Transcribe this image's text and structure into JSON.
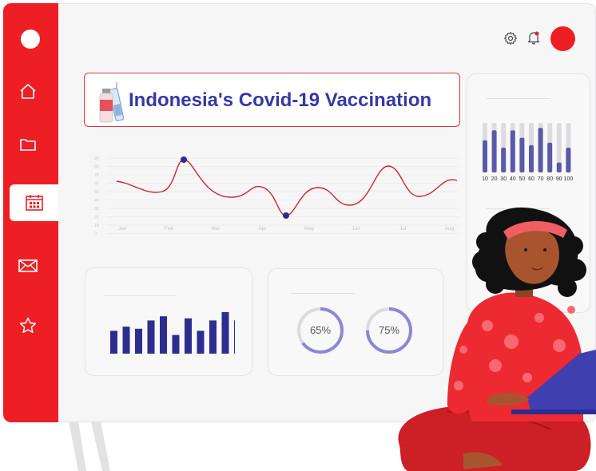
{
  "dashboard": {
    "title": "Indonesia's Covid-19 Vaccination"
  },
  "sidebar": {
    "items": [
      {
        "icon": "home-icon"
      },
      {
        "icon": "folder-icon"
      },
      {
        "icon": "calendar-icon",
        "active": true
      },
      {
        "icon": "mail-icon"
      },
      {
        "icon": "star-icon"
      }
    ]
  },
  "header": {
    "icons": [
      "gear-icon",
      "bell-icon"
    ]
  },
  "line_chart": {
    "months": [
      "Jan",
      "Feb",
      "Mar",
      "Apr",
      "May",
      "Jun",
      "Jul",
      "Aug"
    ],
    "y_ticks": [
      "90",
      "80",
      "70",
      "60",
      "50",
      "40",
      "30",
      "20",
      "10",
      "0"
    ]
  },
  "right_bar_chart": {
    "labels": [
      "10",
      "20",
      "30",
      "40",
      "50",
      "60",
      "70",
      "80",
      "90",
      "100"
    ],
    "fill": [
      0.65,
      0.85,
      0.5,
      0.85,
      0.7,
      0.55,
      0.9,
      0.6,
      0.2,
      0.5
    ]
  },
  "mini_bar_chart": {
    "heights": [
      0.55,
      0.65,
      0.6,
      0.8,
      0.9,
      0.45,
      0.85,
      0.55,
      0.8,
      1.0,
      0.8
    ]
  },
  "progress_rings": [
    {
      "label": "65%",
      "value": 0.65
    },
    {
      "label": "75%",
      "value": 0.75
    }
  ],
  "colors": {
    "accent_red": "#ed1f24",
    "title_blue": "#3737a6",
    "bar_purple": "#5b5aa6",
    "dark_navy": "#2d2d8f",
    "ring_purple": "#8c87d4"
  }
}
